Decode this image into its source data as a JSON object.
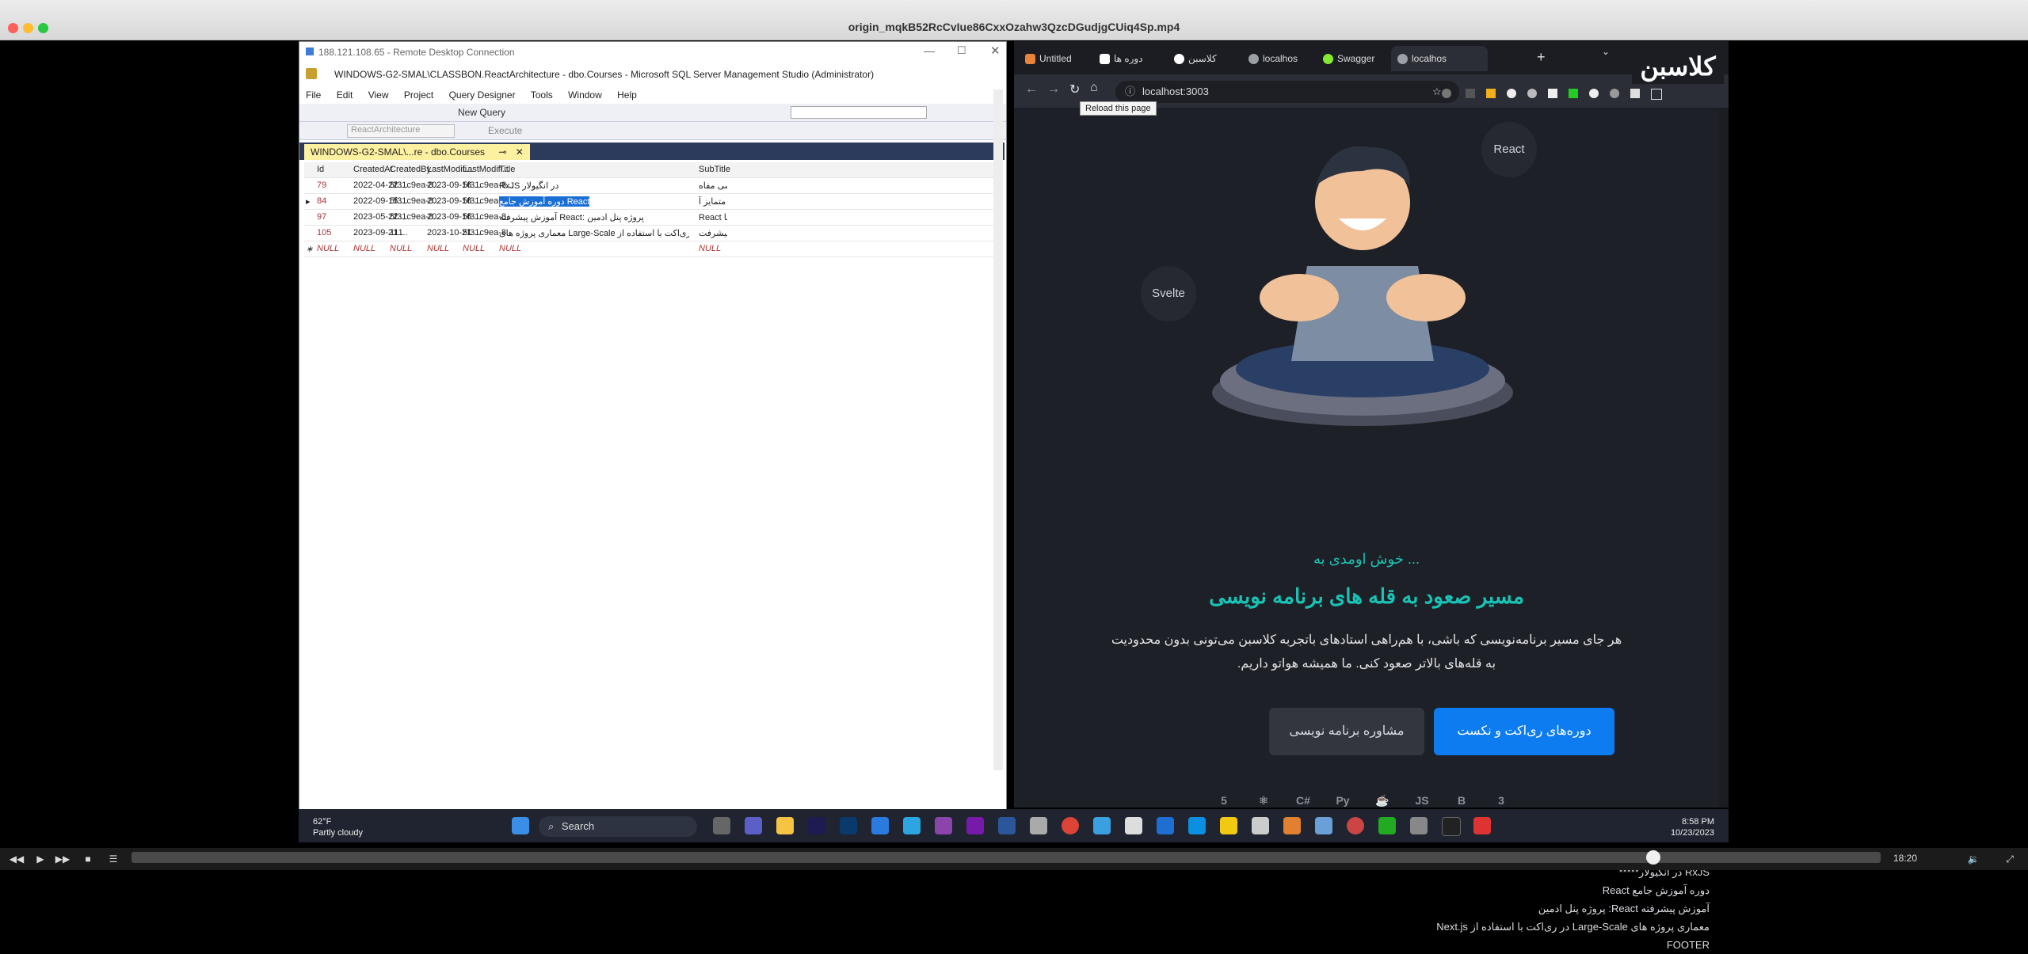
{
  "mac": {
    "title": "origin_mqkB52RcCvIue86CxxOzahw3QzcDGudjgCUiq4Sp.mp4"
  },
  "player": {
    "time": "18:20",
    "progress_fraction": 0.87
  },
  "rdp": {
    "title": "188.121.108.65 - Remote Desktop Connection",
    "ssms_title": "WINDOWS-G2-SMAL\\CLASSBON.ReactArchitecture - dbo.Courses - Microsoft SQL Server Management Studio (Administrator)",
    "menu": [
      "File",
      "Edit",
      "View",
      "Project",
      "Query Designer",
      "Tools",
      "Window",
      "Help"
    ],
    "toolbar": {
      "new_query": "New Query",
      "db": "ReactArchitecture",
      "execute": "Execute"
    },
    "doc_tab": "WINDOWS-G2-SMAL\\...re - dbo.Courses",
    "columns": [
      "Id",
      "CreatedAt",
      "CreatedBy",
      "LastModifi...",
      "LastModifi...",
      "Title",
      "SubTitle"
    ],
    "rows": [
      {
        "id": "79",
        "created_at": "2022-04-22 ...",
        "created_by": "5f31c9ea-8...",
        "mod1": "2023-09-16 ...",
        "mod2": "5f31c9ea-8...",
        "title": "RxJS در انگیولار",
        "subtitle": "بررسی مفاه..."
      },
      {
        "id": "84",
        "created_at": "2022-09-15 ...",
        "created_by": "5f31c9ea-8...",
        "mod1": "2023-09-16 ...",
        "mod2": "5f31c9ea-8...",
        "title": "دوره آموزش جامع React",
        "subtitle": "دوره متمایز آ..."
      },
      {
        "id": "97",
        "created_at": "2023-05-22 ...",
        "created_by": "5f31c9ea-8...",
        "mod1": "2023-09-16 ...",
        "mod2": "5f31c9ea-8...",
        "title": "آموزش پیشرفته React: پروژه پنل ادمین",
        "subtitle": "React اگه با"
      },
      {
        "id": "105",
        "created_at": "2023-09-21 ...",
        "created_by": "111",
        "mod1": "2023-10-21 ...",
        "mod2": "5f31c9ea-8...",
        "title": "معماری پروژه های Large-Scale در ری‌اکت با استفاده از Next.js",
        "subtitle": "دوره پیشرفت..."
      },
      {
        "id": "NULL",
        "created_at": "NULL",
        "created_by": "NULL",
        "mod1": "NULL",
        "mod2": "NULL",
        "title": "NULL",
        "subtitle": "NULL"
      }
    ]
  },
  "browser": {
    "tabs": [
      {
        "label": "Untitled",
        "color": "#e8833a"
      },
      {
        "label": "دوره ها",
        "color": "#ffffff"
      },
      {
        "label": "کلاسبن",
        "color": "#ffffff"
      },
      {
        "label": "localhos",
        "color": "#9aa0a6"
      },
      {
        "label": "Swagger",
        "color": "#85ea2d"
      },
      {
        "label": "localhos",
        "color": "#9aa0a6"
      }
    ],
    "url": "localhost:3003",
    "tooltip": "Reload this page"
  },
  "hero": {
    "logo": "کلاسبن",
    "bubble_react": "React",
    "bubble_svelte": "Svelte",
    "welcome": "خوش اومدی به ...",
    "headline": "مسیر صعود به قله های برنامه نویسی",
    "description": "هر جای مسیر برنامه‌نویسی که باشی، با هم‌راهی استادهای باتجربه کلاسبن می‌تونی بدون محدودیت به قله‌های بالاتر صعود کنی. ما همیشه هواتو داریم.",
    "primary_button": "دوره‌های ری‌اکت و نکست",
    "secondary_button": "مشاوره برنامه نویسی",
    "tech_icons": [
      "html5-icon",
      "react-icon",
      "csharp-icon",
      "python-icon",
      "java-icon",
      "nodejs-icon",
      "bootstrap-icon",
      "css3-icon"
    ],
    "footer_items": [
      "RxJS در انگیولار*****",
      "دوره آموزش جامع React",
      "آموزش پیشرفته React: پروژه پنل ادمین",
      "معماری پروژه های Large-Scale در ری‌اکت با استفاده از Next.js"
    ],
    "footer_label": "FOOTER"
  },
  "taskbar": {
    "temperature": "62°F",
    "condition": "Partly cloudy",
    "search": "Search",
    "time": "8:58 PM",
    "date": "10/23/2023"
  }
}
